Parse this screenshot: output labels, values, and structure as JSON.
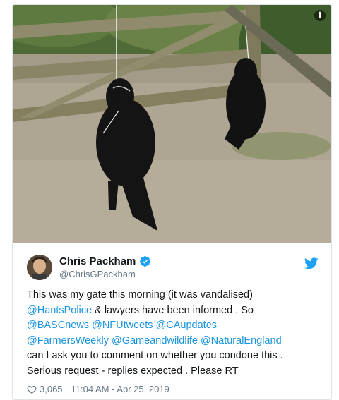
{
  "photo": {
    "alt_icon": "info-icon",
    "info_glyph": "i"
  },
  "author": {
    "name": "Chris Packham",
    "handle": "@ChrisGPackham",
    "verified_icon": "verified-badge-icon",
    "avatar_icon": "avatar"
  },
  "brand": {
    "icon": "twitter-bird-icon",
    "color": "#1da1f2"
  },
  "tweet": {
    "line1": "This was my gate this morning (it was vandalised)",
    "line2_mention": "@HantsPolice",
    "line2_rest": " & lawyers have been informed . So",
    "line3_mention1": "@BASCnews",
    "line3_mention2": "@NFUtweets",
    "line3_mention3": "@CAupdates",
    "line4_mention1": "@FarmersWeekly",
    "line4_mention2": "@Gameandwildlife",
    "line4_mention3": "@NaturalEngland",
    "line5": "can I ask you to comment on whether you condone this .",
    "line6": "Serious request - replies expected . Please RT"
  },
  "footer": {
    "heart_icon": "heart-icon",
    "likes": "3,065",
    "timestamp": "11:04 AM - Apr 25, 2019"
  },
  "colors": {
    "mention": "#1b95e0",
    "secondary_text": "#657786",
    "primary_text": "#14171a",
    "border": "#dfe3e6"
  }
}
